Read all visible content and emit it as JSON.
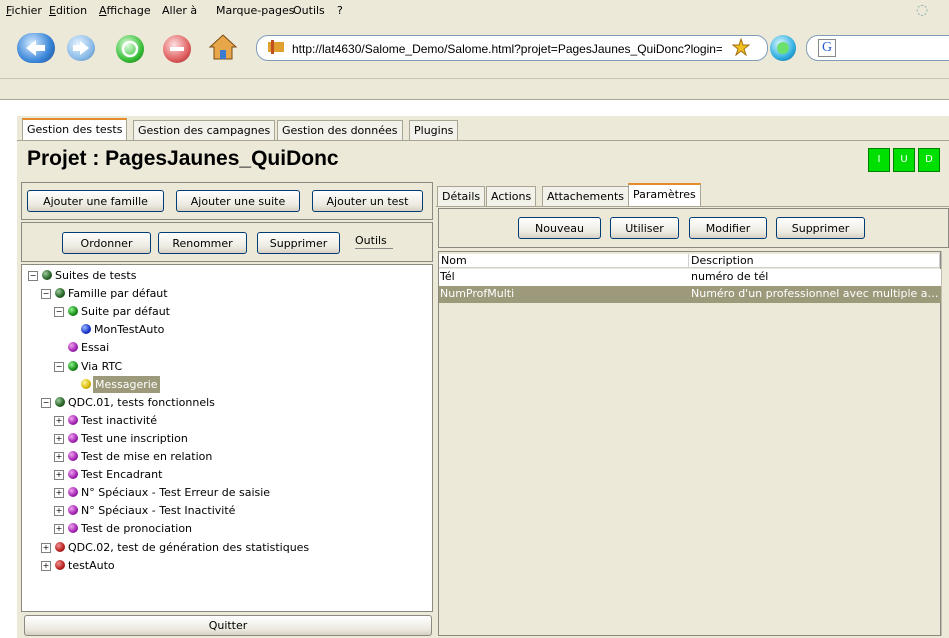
{
  "browser": {
    "menu": [
      "Fichier",
      "Edition",
      "Affichage",
      "Aller à",
      "Marque-pages",
      "Outils",
      "?"
    ],
    "url": "http://lat4630/Salome_Demo/Salome.html?projet=PagesJaunes_QuiDonc?login=",
    "search_value": ""
  },
  "app": {
    "tabs": [
      "Gestion des tests",
      "Gestion des campagnes",
      "Gestion des données",
      "Plugins"
    ],
    "active_tab": "Gestion des tests",
    "project_title": "Projet : PagesJaunes_QuiDonc",
    "status_buttons": [
      "I",
      "U",
      "D"
    ],
    "status_color": "#00e000",
    "left_buttons_row1": [
      "Ajouter une famille",
      "Ajouter une suite",
      "Ajouter un test"
    ],
    "left_buttons_row2": [
      "Ordonner",
      "Renommer",
      "Supprimer"
    ],
    "tools_label": "Outils",
    "quit_button": "Quitter",
    "tree": [
      {
        "label": "Suites de tests",
        "icon": "dark-ball",
        "expander": "minus"
      },
      {
        "label": "Famille par défaut",
        "icon": "dark-ball",
        "expander": "minus"
      },
      {
        "label": "Suite par défaut",
        "icon": "green-ball",
        "expander": "minus"
      },
      {
        "label": "MonTestAuto",
        "icon": "blue-ball",
        "expander": ""
      },
      {
        "label": "Essai",
        "icon": "purple-ball",
        "expander": ""
      },
      {
        "label": "Via RTC",
        "icon": "green-ball",
        "expander": "minus"
      },
      {
        "label": "Messagerie",
        "icon": "yellow-ball",
        "expander": "",
        "selected": true
      },
      {
        "label": "QDC.01, tests fonctionnels",
        "icon": "dark-ball",
        "expander": "minus"
      },
      {
        "label": "Test  inactivité",
        "icon": "purple-ball",
        "expander": "plus"
      },
      {
        "label": "Test une inscription",
        "icon": "purple-ball",
        "expander": "plus"
      },
      {
        "label": "Test de mise en relation",
        "icon": "purple-ball",
        "expander": "plus"
      },
      {
        "label": "Test Encadrant",
        "icon": "purple-ball",
        "expander": "plus"
      },
      {
        "label": "N° Spéciaux - Test Erreur de saisie",
        "icon": "purple-ball",
        "expander": "plus"
      },
      {
        "label": "N° Spéciaux - Test Inactivité",
        "icon": "purple-ball",
        "expander": "plus"
      },
      {
        "label": "Test de pronociation",
        "icon": "purple-ball",
        "expander": "plus"
      },
      {
        "label": "QDC.02, test de génération des statistiques",
        "icon": "red-ball",
        "expander": "plus"
      },
      {
        "label": "testAuto",
        "icon": "red-ball",
        "expander": "plus"
      }
    ],
    "right_tabs": [
      "Détails",
      "Actions",
      "Attachements",
      "Paramètres"
    ],
    "active_right_tab": "Paramètres",
    "param_buttons": [
      "Nouveau",
      "Utiliser",
      "Modifier",
      "Supprimer"
    ],
    "param_table": {
      "columns": [
        "Nom",
        "Description"
      ],
      "rows": [
        {
          "name": "Tél",
          "description": "numéro de tél",
          "selected": false
        },
        {
          "name": "NumProfMulti",
          "description": "Numéro d'un professionnel avec multiple ac...",
          "selected": true
        }
      ]
    },
    "selection_color": "#9c9a7a"
  }
}
